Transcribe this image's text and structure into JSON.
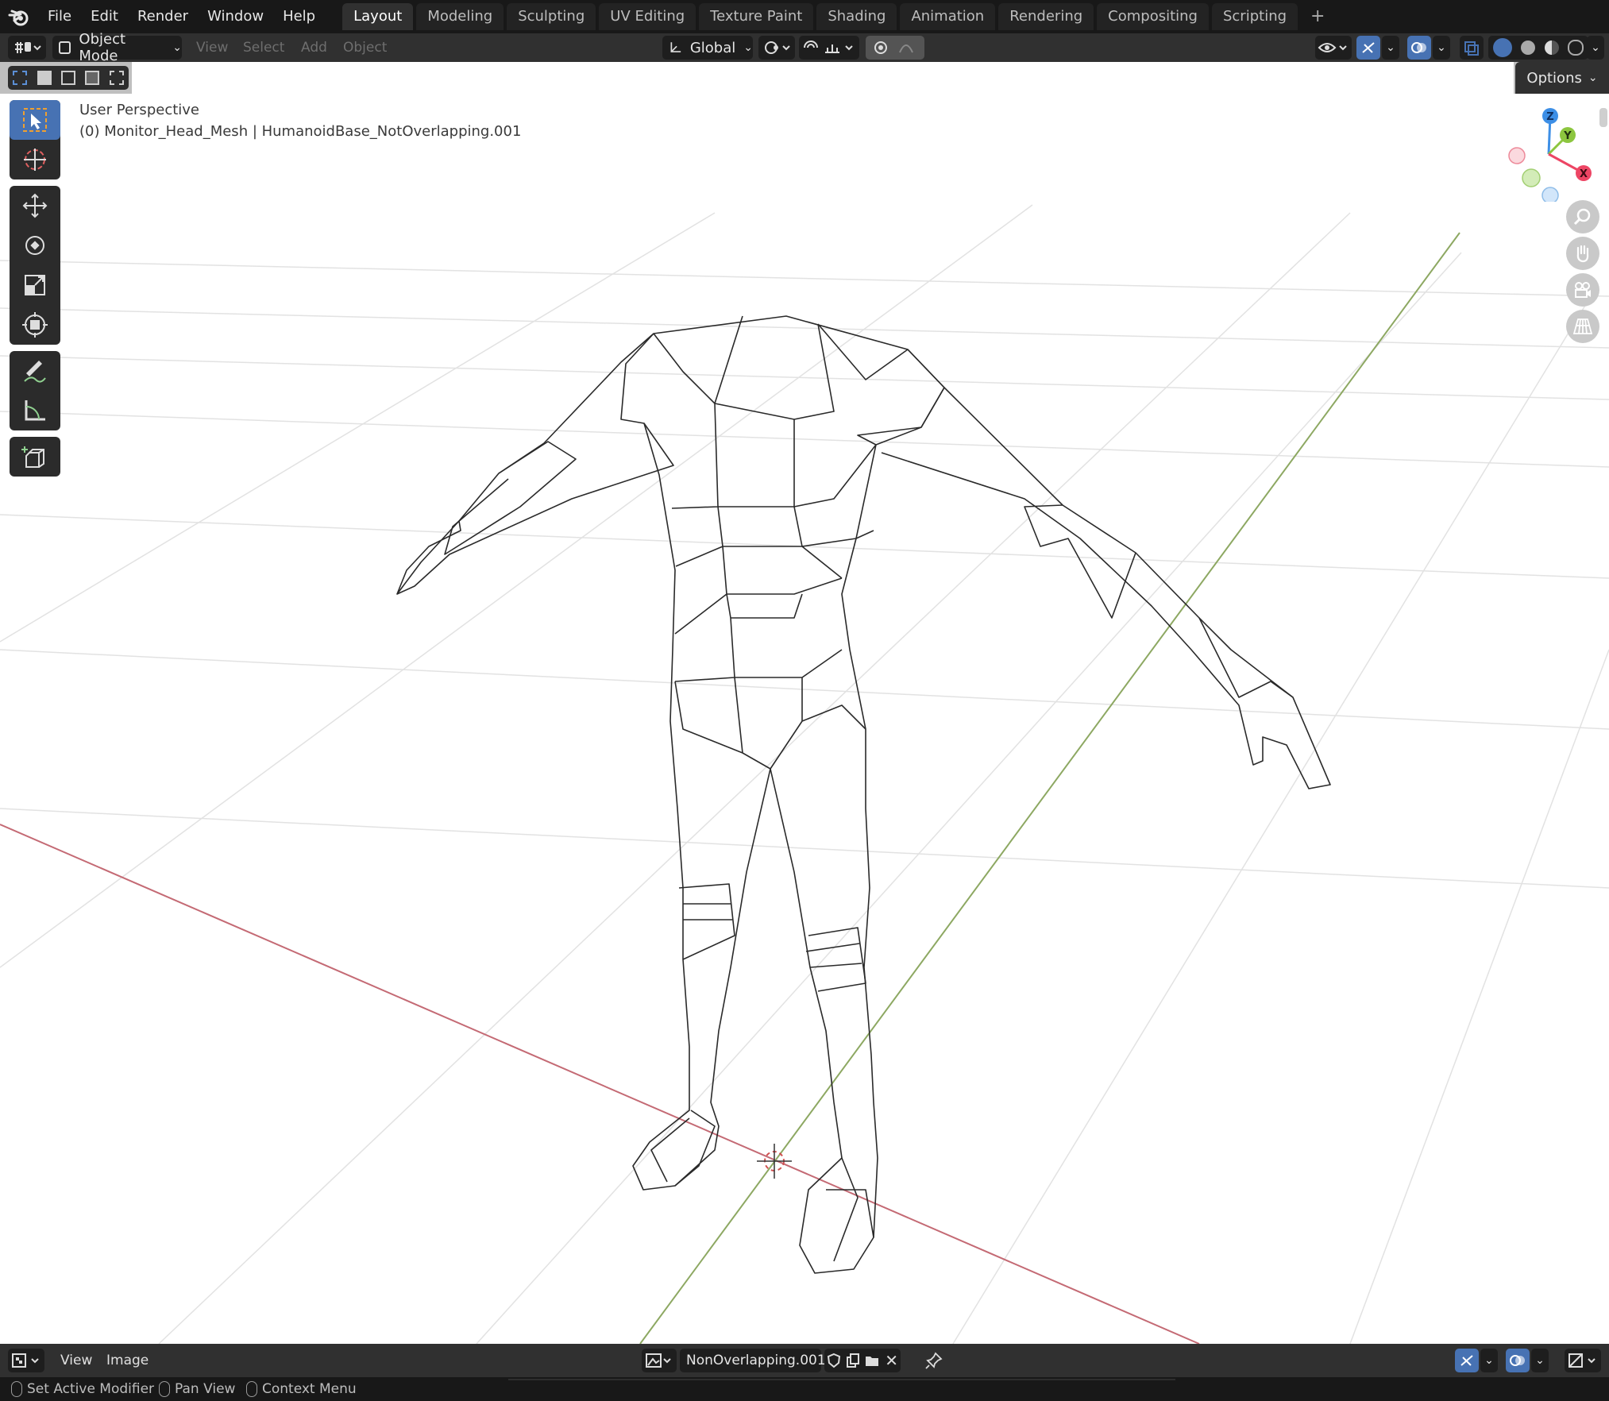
{
  "app": {
    "logo": "blender-logo"
  },
  "menubar": {
    "items": [
      "File",
      "Edit",
      "Render",
      "Window",
      "Help"
    ]
  },
  "workspaces": {
    "tabs": [
      "Layout",
      "Modeling",
      "Sculpting",
      "UV Editing",
      "Texture Paint",
      "Shading",
      "Animation",
      "Rendering",
      "Compositing",
      "Scripting"
    ],
    "active": "Layout",
    "add_icon": "plus-icon"
  },
  "header": {
    "mode": "Object Mode",
    "menus": [
      "View",
      "Select",
      "Add",
      "Object"
    ],
    "transform_orientation": "Global"
  },
  "tool_settings": {
    "options_label": "Options"
  },
  "viewport": {
    "perspective_label": "User Perspective",
    "object_info": "(0) Monitor_Head_Mesh | HumanoidBase_NotOverlapping.001",
    "gizmo_axes": [
      "Z",
      "Y",
      "X"
    ],
    "axis_colors": {
      "x": "#ed4564",
      "y": "#8cc63f",
      "z": "#3d8fe6"
    }
  },
  "toolbar": {
    "tools": [
      "select-box-tool",
      "cursor-tool",
      "move-tool",
      "rotate-tool",
      "scale-tool",
      "transform-tool",
      "annotate-tool",
      "measure-tool",
      "add-cube-tool"
    ]
  },
  "bottom_editor": {
    "menus": [
      "View",
      "Image"
    ],
    "image_name": "NonOverlapping.001"
  },
  "status": {
    "hints": [
      "Set Active Modifier",
      "Pan View",
      "Context Menu"
    ]
  },
  "colors": {
    "accent": "#4772b3",
    "bar": "#303030",
    "topbar": "#181818"
  }
}
